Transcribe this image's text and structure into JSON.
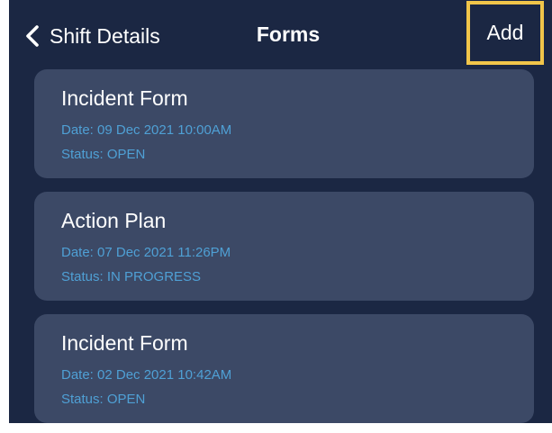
{
  "nav": {
    "back_label": "Shift Details",
    "title": "Forms",
    "add_label": "Add"
  },
  "forms": [
    {
      "title": "Incident Form",
      "date": "Date: 09 Dec 2021 10:00AM",
      "status": "Status: OPEN"
    },
    {
      "title": "Action Plan",
      "date": "Date: 07 Dec 2021 11:26PM",
      "status": "Status: IN PROGRESS"
    },
    {
      "title": "Incident Form",
      "date": "Date: 02 Dec 2021 10:42AM",
      "status": "Status: OPEN"
    }
  ],
  "colors": {
    "background": "#1b2743",
    "card": "#3c4966",
    "accent_text": "#4fa0d5",
    "highlight": "#f1c54a"
  }
}
